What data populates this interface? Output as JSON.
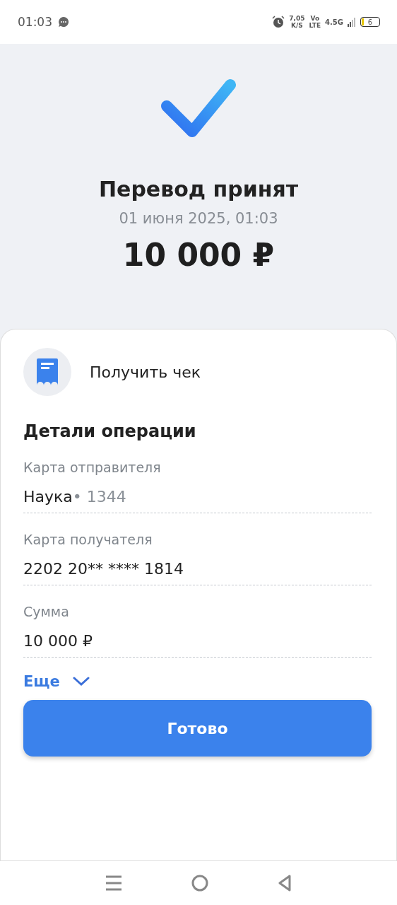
{
  "status_bar": {
    "time": "01:03",
    "speed": "7,05",
    "speed_unit": "K/S",
    "volte_top": "Vo",
    "volte_bottom": "LTE",
    "network": "4.5G",
    "battery": "6"
  },
  "header": {
    "title": "Перевод принят",
    "date": "01 июня 2025, 01:03",
    "amount": "10 000 ₽"
  },
  "receipt": {
    "label": "Получить чек"
  },
  "details": {
    "title": "Детали операции",
    "fields": [
      {
        "label": "Карта отправителя",
        "value": "Наука",
        "suffix": "• 1344"
      },
      {
        "label": "Карта получателя",
        "value": "2202 20** **** 1814"
      },
      {
        "label": "Сумма",
        "value": "10 000 ₽"
      }
    ],
    "more": "Еще"
  },
  "done_button": "Готово"
}
